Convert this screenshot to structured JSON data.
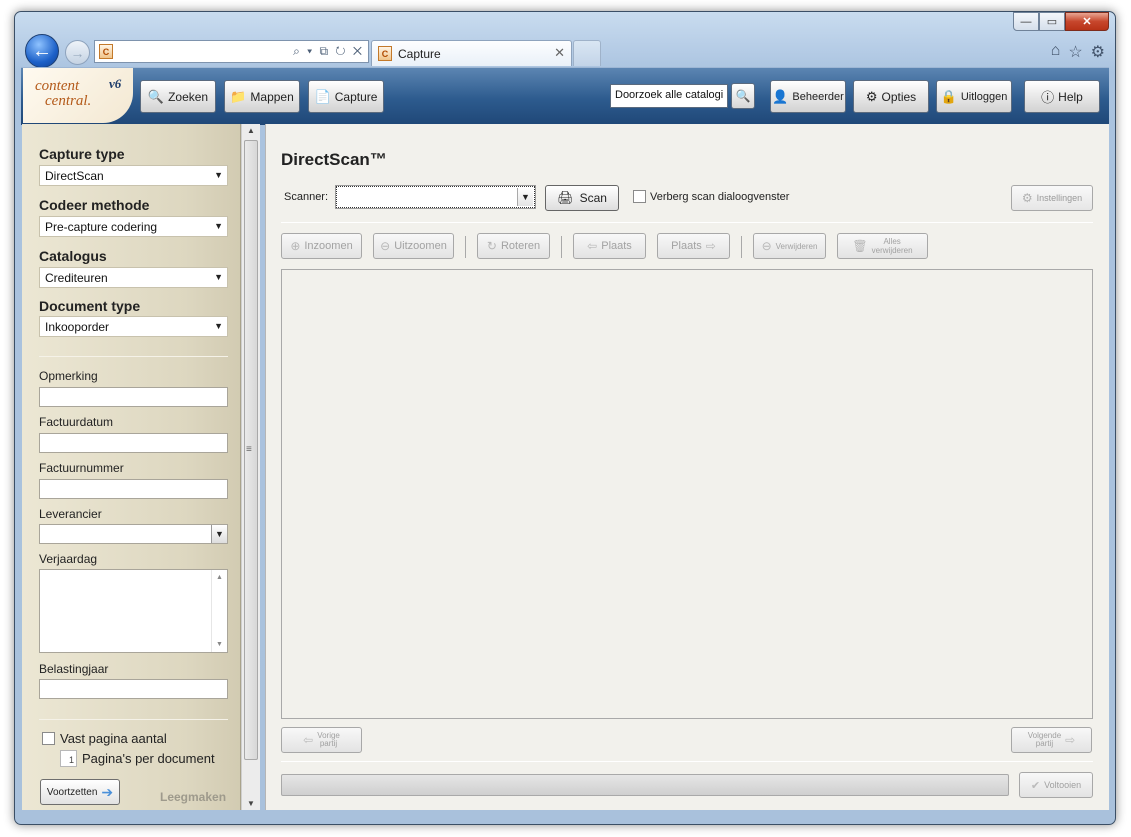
{
  "browser": {
    "back_icon": "arrow-left-icon",
    "forward_icon": "arrow-right-icon",
    "address_tools": "⌕ ▾ ⧉ ↻ ✕",
    "tab_title": "Capture",
    "tab_close": "✕",
    "window_controls": {
      "minimize": "—",
      "maximize": "▭",
      "close": "✕"
    }
  },
  "header": {
    "logo": {
      "line1": "content",
      "line2": "central.",
      "version": "v6"
    },
    "nav": {
      "zoeken": "Zoeken",
      "mappen": "Mappen",
      "capture": "Capture"
    },
    "search_value": "Doorzoek alle catalogi",
    "right": {
      "beheerder": "Beheerder",
      "opties": "Opties",
      "uitloggen": "Uitloggen",
      "help": "Help"
    }
  },
  "sidebar": {
    "capture_type_label": "Capture type",
    "capture_type_value": "DirectScan",
    "codeer_label": "Codeer methode",
    "codeer_value": "Pre-capture codering",
    "catalogus_label": "Catalogus",
    "catalogus_value": "Crediteuren",
    "doctype_label": "Document type",
    "doctype_value": "Inkooporder",
    "fields": {
      "opmerking": "Opmerking",
      "factuurdatum": "Factuurdatum",
      "factuurnummer": "Factuurnummer",
      "leverancier": "Leverancier",
      "verjaardag": "Verjaardag",
      "belastingjaar": "Belastingjaar"
    },
    "vast_pagina_label": "Vast pagina aantal",
    "ppd_value": "1",
    "ppd_label": "Pagina's per document",
    "voortzetten": "Voortzetten",
    "leegmaken": "Leegmaken"
  },
  "main": {
    "title": "DirectScan™",
    "scanner_label": "Scanner:",
    "scanner_value": "",
    "scan_button": "Scan",
    "hide_dialog_label": "Verberg scan dialoogvenster",
    "settings_button": "Instellingen",
    "toolbar": {
      "inzoomen": "Inzoomen",
      "uitzoomen": "Uitzoomen",
      "roteren": "Roteren",
      "plaats_left": "Plaats",
      "plaats_right": "Plaats",
      "verwijderen": "Verwijderen",
      "alles_line1": "Alles",
      "alles_line2": "verwijderen"
    },
    "vorige_line1": "Vorige",
    "vorige_line2": "partij",
    "volgende_line1": "Volgende",
    "volgende_line2": "partij",
    "voltooien": "Voltooien"
  }
}
